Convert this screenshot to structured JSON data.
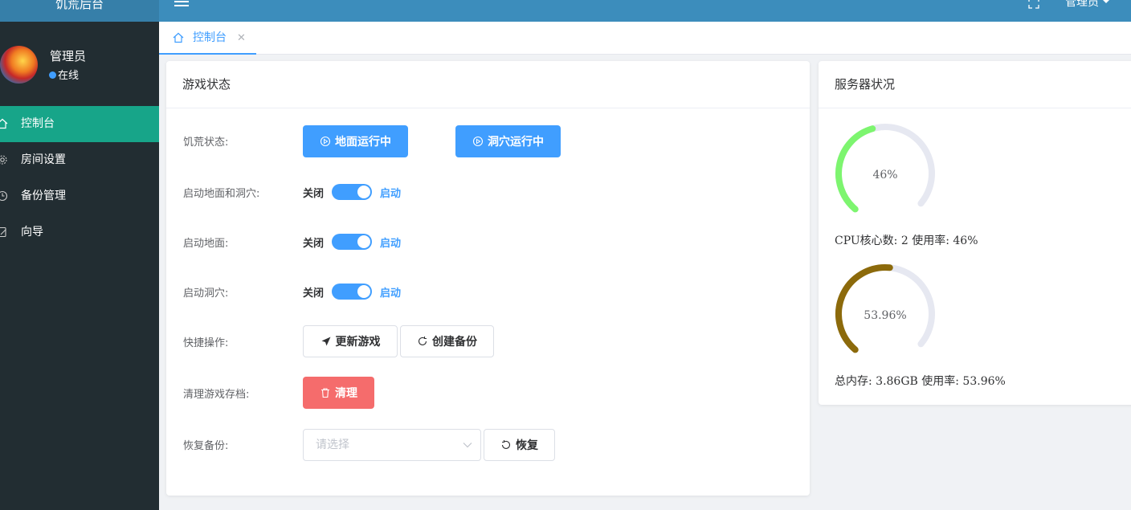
{
  "app": {
    "title": "饥荒后台"
  },
  "header": {
    "user_menu_label": "管理员"
  },
  "user": {
    "name": "管理员",
    "status": "在线"
  },
  "sidebar": {
    "items": [
      {
        "label": "控制台",
        "icon": "home-icon",
        "active": true
      },
      {
        "label": "房间设置",
        "icon": "gear-icon",
        "active": false
      },
      {
        "label": "备份管理",
        "icon": "clock-icon",
        "active": false
      },
      {
        "label": "向导",
        "icon": "guide-icon",
        "active": false
      }
    ]
  },
  "tabs": [
    {
      "label": "控制台",
      "closable": true
    }
  ],
  "game_status": {
    "title": "游戏状态",
    "rows": {
      "status_label": "饥荒状态:",
      "surface_running": "地面运行中",
      "cave_running": "洞穴运行中",
      "both_label": "启动地面和洞穴:",
      "surface_label": "启动地面:",
      "cave_label": "启动洞穴:",
      "switch_off_text": "关闭",
      "switch_on_text": "启动",
      "switches": {
        "both": true,
        "surface": true,
        "cave": true
      },
      "quick_label": "快捷操作:",
      "update_game": "更新游戏",
      "create_backup": "创建备份",
      "clear_label": "清理游戏存档:",
      "clear_button": "清理",
      "restore_label": "恢复备份:",
      "restore_placeholder": "请选择",
      "restore_button": "恢复"
    }
  },
  "server_status": {
    "title": "服务器状况",
    "cpu": {
      "percent": 46,
      "display": "46%",
      "caption": "CPU核心数: 2 使用率: 46%",
      "color": "#7df56f"
    },
    "memory": {
      "percent": 53.96,
      "display": "53.96%",
      "caption": "总内存: 3.86GB 使用率: 53.96%",
      "color": "#8c6a0b"
    },
    "track_color": "#e6e8f1"
  },
  "colors": {
    "primary": "#409eff",
    "danger": "#f56c6c",
    "sidebar_bg": "#222d32",
    "sidebar_active": "#17a589",
    "header_bg": "#3c8dbc"
  }
}
